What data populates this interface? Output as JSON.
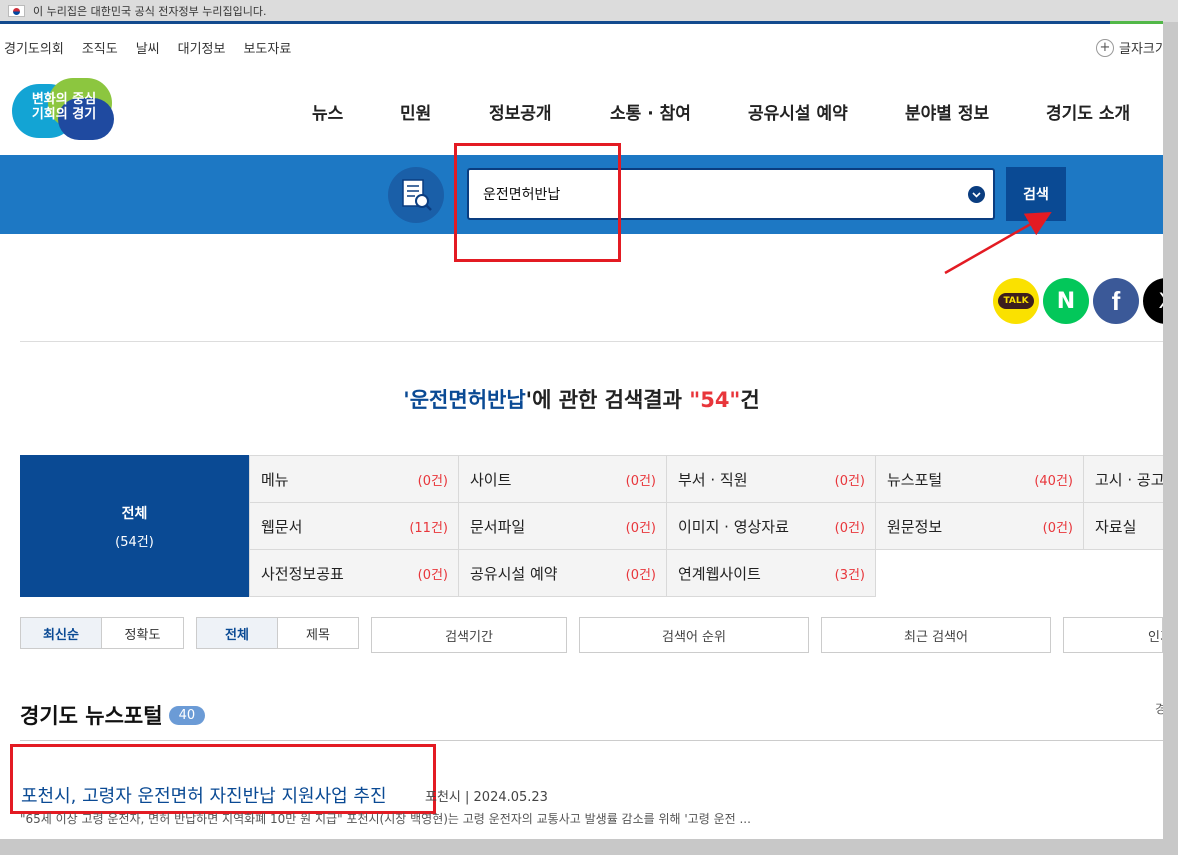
{
  "gov_banner": {
    "text": "이 누리집은 대한민국 공식 전자정부 누리집입니다."
  },
  "utility_links": [
    "경기도의회",
    "조직도",
    "날씨",
    "대기정보",
    "보도자료"
  ],
  "font_size_label": "글자크기",
  "logo_text": [
    "변화의 중심",
    "기회의 경기"
  ],
  "gnb": [
    "뉴스",
    "민원",
    "정보공개",
    "소통 · 참여",
    "공유시설 예약",
    "분야별 정보",
    "경기도 소개"
  ],
  "search": {
    "value": "운전면허반납",
    "button": "검색"
  },
  "share": {
    "kakao": "TALK",
    "naver": "N",
    "facebook": "f",
    "x": "X"
  },
  "result": {
    "prefix": "'",
    "keyword": "운전면허반납",
    "middle": "'에 관한 검색결과 ",
    "count": "\"54\"",
    "suffix": "건"
  },
  "categories": {
    "all": {
      "label": "전체",
      "count": "(54건)"
    },
    "cells": [
      {
        "label": "메뉴",
        "count": "(0건)"
      },
      {
        "label": "사이트",
        "count": "(0건)"
      },
      {
        "label": "부서 · 직원",
        "count": "(0건)"
      },
      {
        "label": "뉴스포털",
        "count": "(40건)"
      },
      {
        "label": "고시 · 공고/",
        "count": ""
      },
      {
        "label": "웹문서",
        "count": "(11건)"
      },
      {
        "label": "문서파일",
        "count": "(0건)"
      },
      {
        "label": "이미지 · 영상자료",
        "count": "(0건)"
      },
      {
        "label": "원문정보",
        "count": "(0건)"
      },
      {
        "label": "자료실",
        "count": ""
      },
      {
        "label": "사전정보공표",
        "count": "(0건)"
      },
      {
        "label": "공유시설 예약",
        "count": "(0건)"
      },
      {
        "label": "연계웹사이트",
        "count": "(3건)"
      }
    ]
  },
  "sort": {
    "latest": "최신순",
    "accuracy": "정확도",
    "all": "전체",
    "title": "제목"
  },
  "options": [
    "검색기간",
    "검색어 순위",
    "최근 검색어",
    "인기 검"
  ],
  "section": {
    "title": "경기도 뉴스포털",
    "count": "40",
    "right_edge": "경"
  },
  "news": [
    {
      "title": "포천시, 고령자 운전면허 자진반납 지원사업 추진",
      "meta": "포천시 | 2024.05.23",
      "desc": "\"65세 이상 고령 운전자, 면허 반납하면 지역화폐 10만 원 지급\" 포천시(시장 백영현)는 고령 운전자의 교통사고 발생률 감소를 위해 '고령 운전 ..."
    }
  ],
  "colors": {
    "primary": "#0a4a94",
    "band": "#1d78c4",
    "accent_red": "#e31b23",
    "count_red": "#e8363b"
  }
}
